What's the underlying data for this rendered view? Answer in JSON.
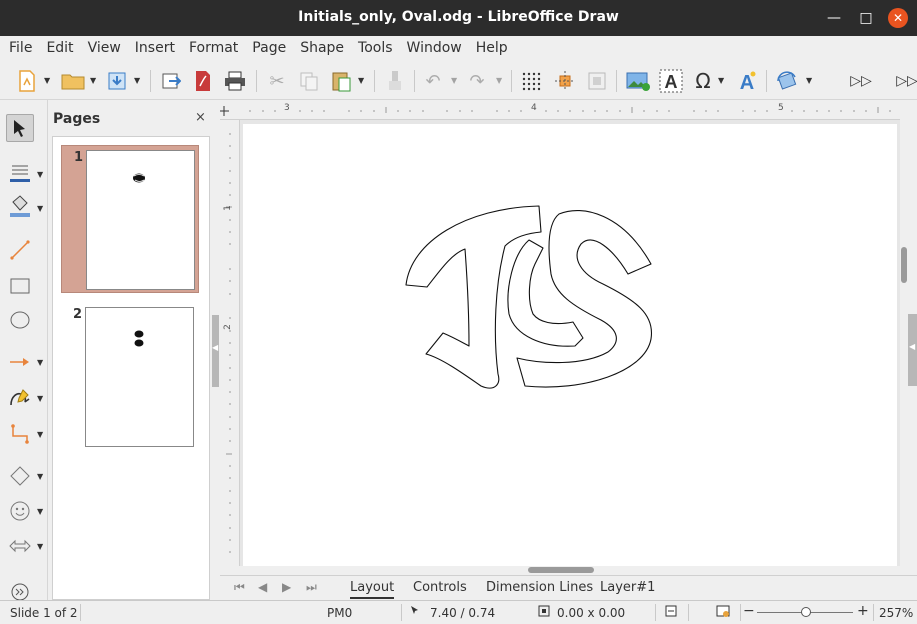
{
  "window": {
    "title": "Initials_only, Oval.odg - LibreOffice Draw"
  },
  "menu": [
    "File",
    "Edit",
    "View",
    "Insert",
    "Format",
    "Page",
    "Shape",
    "Tools",
    "Window",
    "Help"
  ],
  "pages_panel": {
    "title": "Pages",
    "close_glyph": "×",
    "slides": [
      {
        "number": "1"
      },
      {
        "number": "2"
      }
    ]
  },
  "rulers": {
    "h_labels": [
      "3",
      "4",
      "5"
    ],
    "v_labels": [
      "1",
      "2"
    ]
  },
  "drawing": {
    "initials": "JCS",
    "stroke_color": "#000000"
  },
  "layer_tabs": [
    "Layout",
    "Controls",
    "Dimension Lines",
    "Layer#1"
  ],
  "status": {
    "slide": "Slide 1 of 2",
    "master": "PM0",
    "position": "7.40 / 0.74",
    "size": "0.00 x 0.00",
    "zoom": "257%",
    "zoom_minus": "−",
    "zoom_plus": "+"
  },
  "accent_color": "#e95420"
}
